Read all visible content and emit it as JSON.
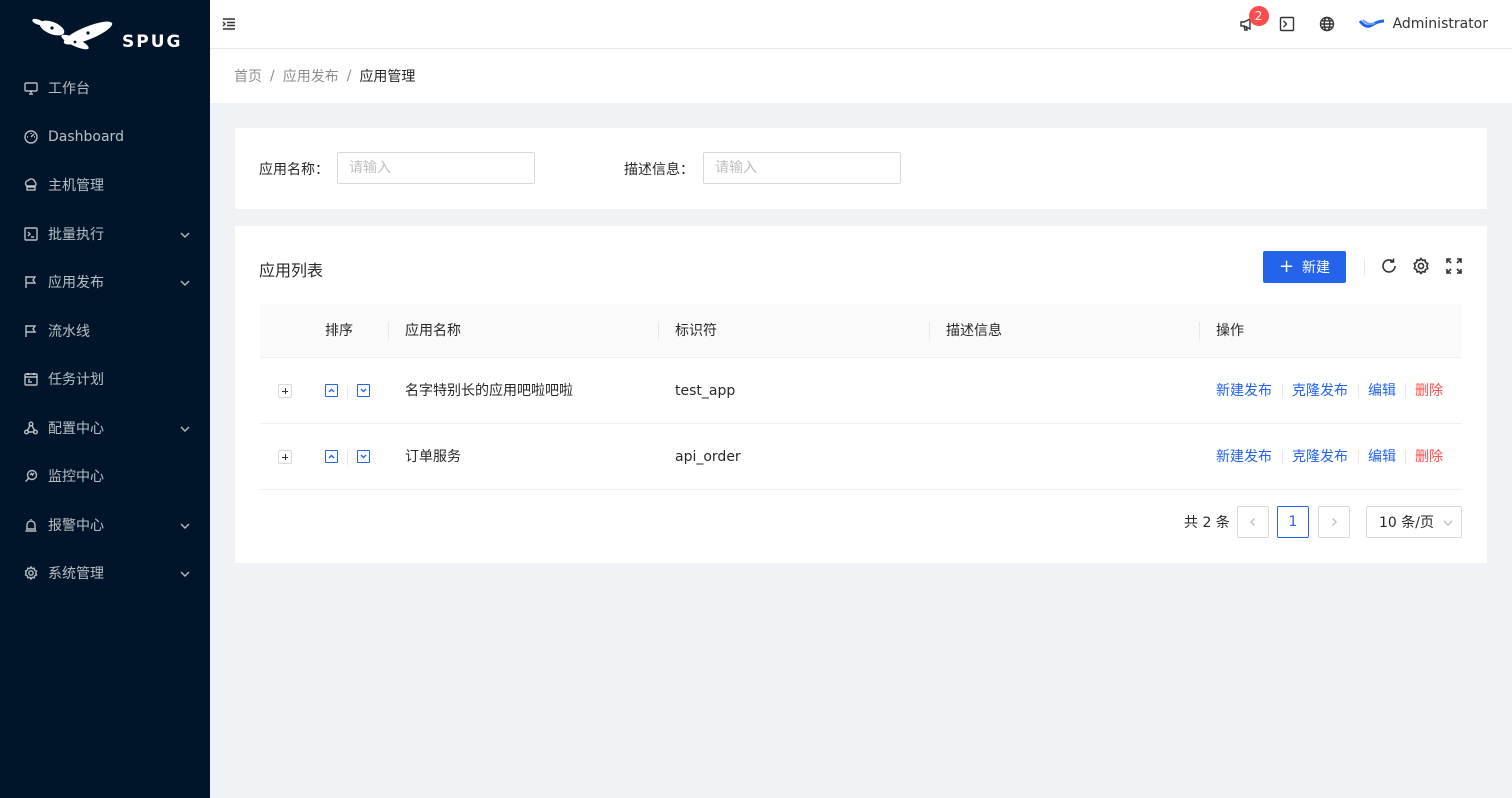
{
  "app": {
    "logo_text": "SPUG"
  },
  "sidebar": {
    "items": [
      {
        "label": "工作台",
        "icon": "desktop-icon",
        "has_children": false
      },
      {
        "label": "Dashboard",
        "icon": "dashboard-icon",
        "has_children": false
      },
      {
        "label": "主机管理",
        "icon": "cloud-server-icon",
        "has_children": false
      },
      {
        "label": "批量执行",
        "icon": "code-icon",
        "has_children": true
      },
      {
        "label": "应用发布",
        "icon": "flag-icon",
        "has_children": true
      },
      {
        "label": "流水线",
        "icon": "flag-icon",
        "has_children": false
      },
      {
        "label": "任务计划",
        "icon": "schedule-icon",
        "has_children": false
      },
      {
        "label": "配置中心",
        "icon": "deployment-unit-icon",
        "has_children": true
      },
      {
        "label": "监控中心",
        "icon": "monitor-icon",
        "has_children": false
      },
      {
        "label": "报警中心",
        "icon": "alert-icon",
        "has_children": true
      },
      {
        "label": "系统管理",
        "icon": "setting-icon",
        "has_children": true
      }
    ]
  },
  "header": {
    "notification_count": "2",
    "username": "Administrator"
  },
  "breadcrumb": [
    "首页",
    "应用发布",
    "应用管理"
  ],
  "search": {
    "name_label": "应用名称：",
    "name_placeholder": "请输入",
    "name_value": "",
    "desc_label": "描述信息：",
    "desc_placeholder": "请输入",
    "desc_value": ""
  },
  "table_card": {
    "title": "应用列表",
    "new_button": "新建"
  },
  "table": {
    "columns": [
      "排序",
      "应用名称",
      "标识符",
      "描述信息",
      "操作"
    ],
    "rows": [
      {
        "name": "名字特别长的应用吧啦吧啦",
        "key": "test_app",
        "desc": ""
      },
      {
        "name": "订单服务",
        "key": "api_order",
        "desc": ""
      }
    ],
    "actions": {
      "new_deploy": "新建发布",
      "clone_deploy": "克隆发布",
      "edit": "编辑",
      "delete": "删除"
    }
  },
  "pagination": {
    "total_text": "共 2 条",
    "current_page": "1",
    "page_size": "10 条/页"
  },
  "colors": {
    "sidebar_bg": "#001529",
    "primary": "#2563eb",
    "danger": "#ff4d4f"
  }
}
